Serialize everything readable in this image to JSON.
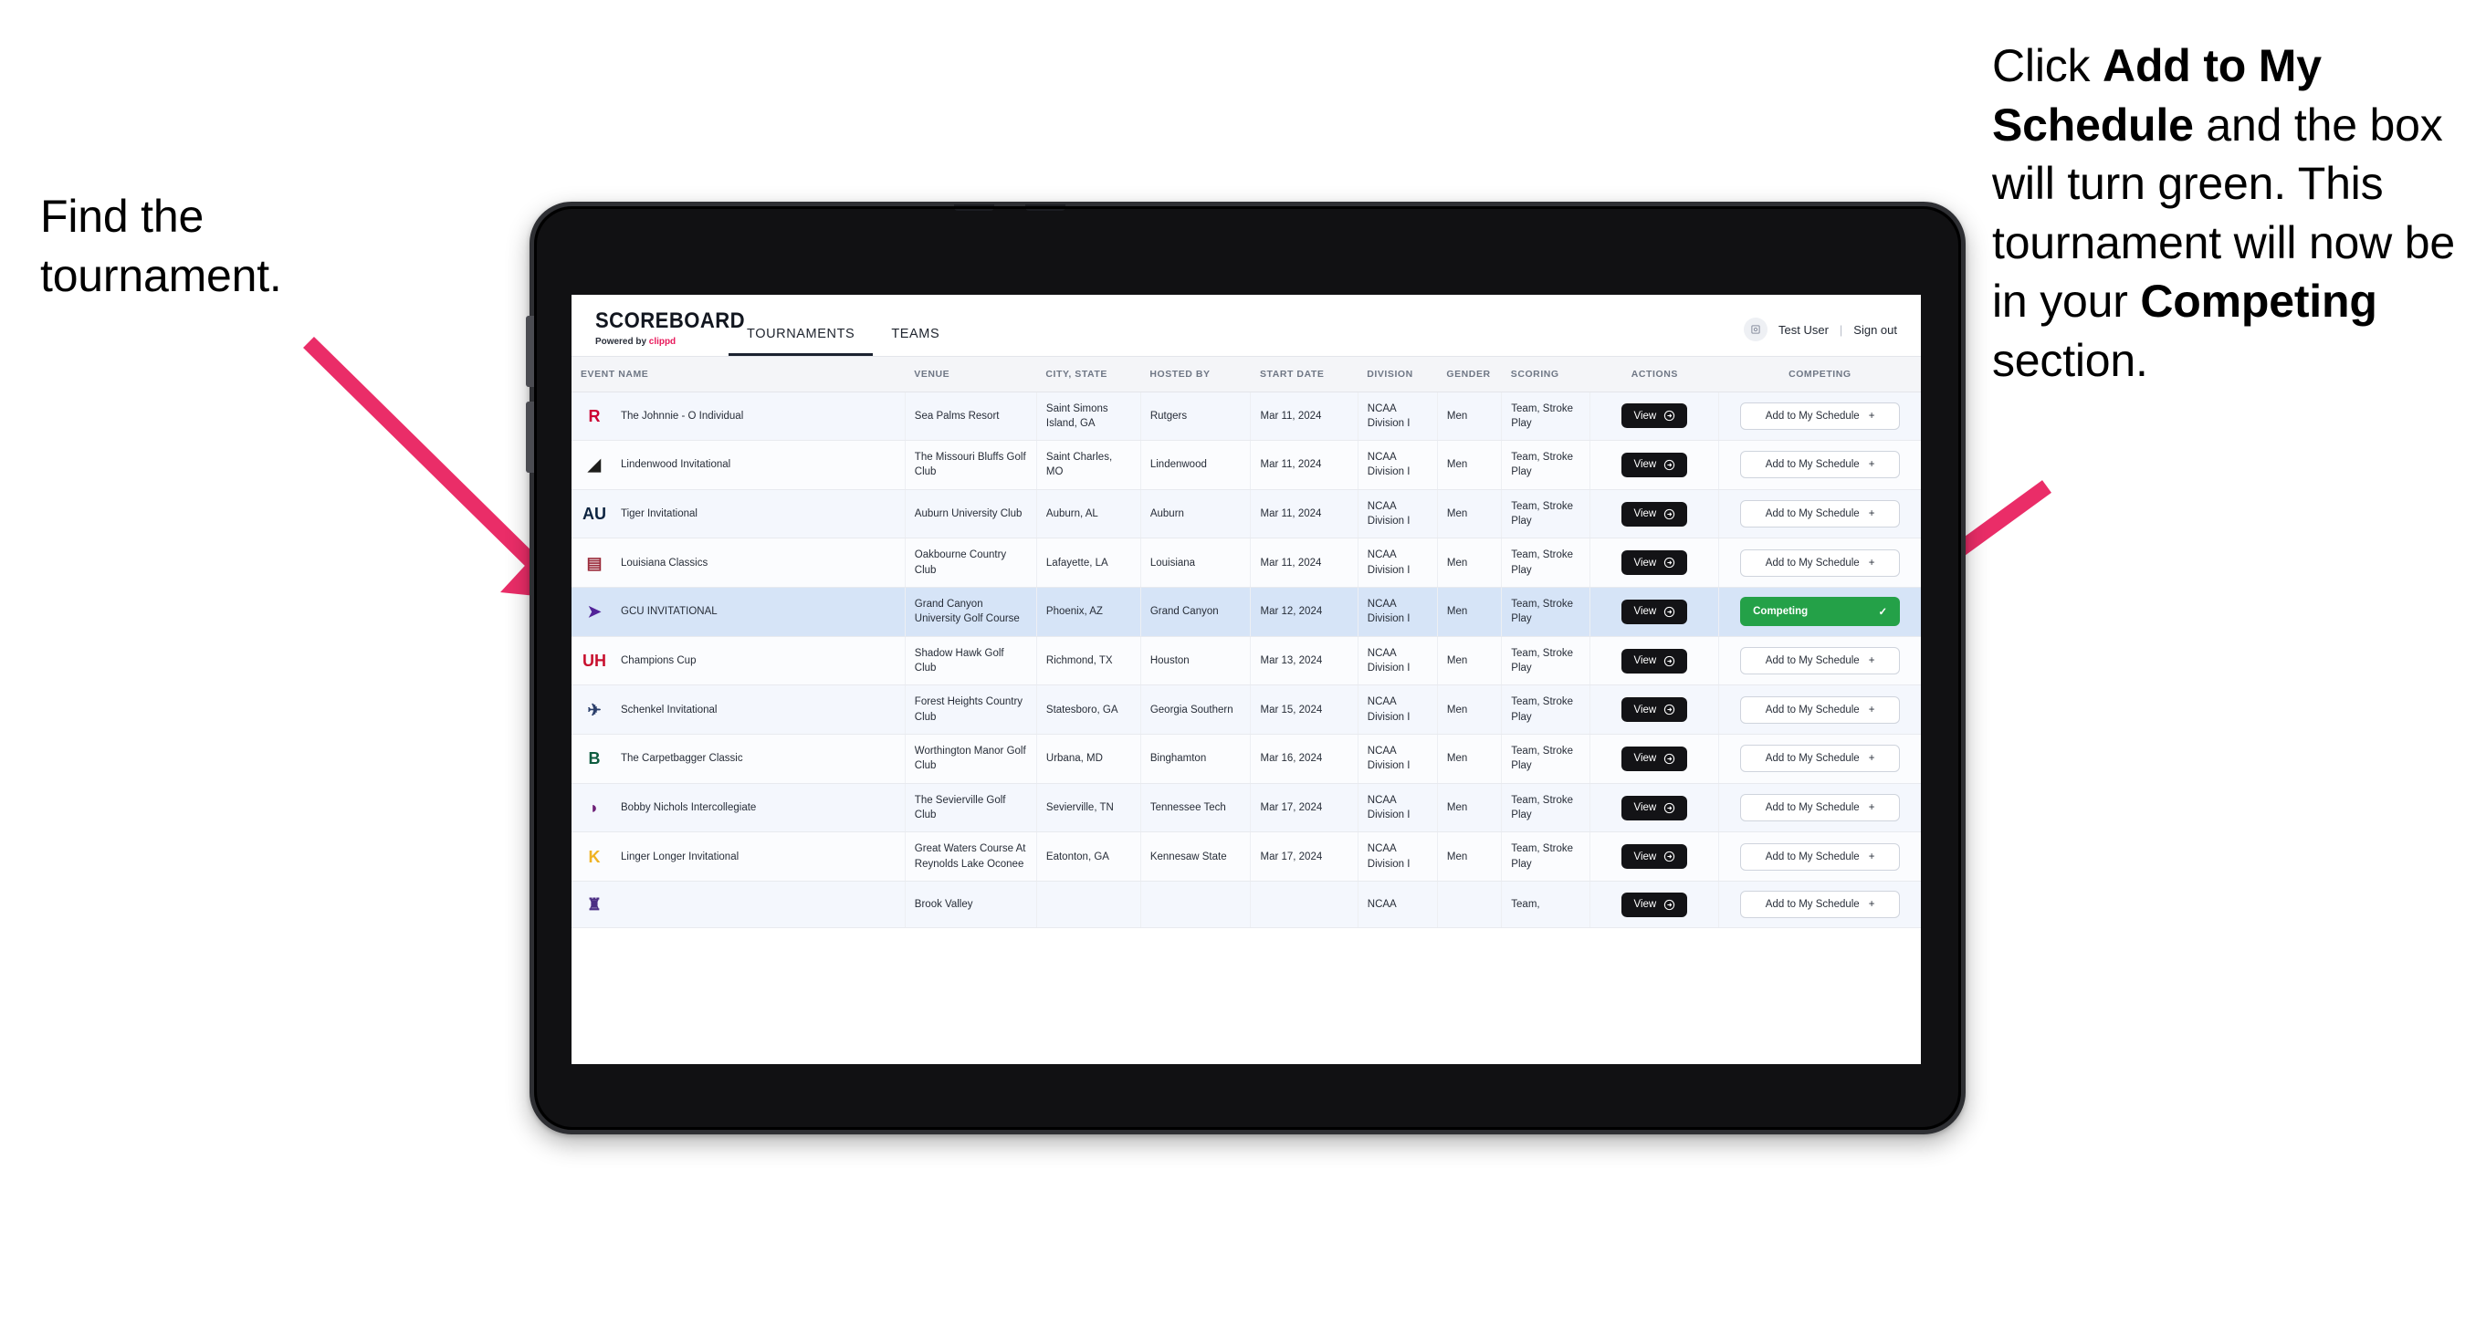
{
  "annotations": {
    "left": {
      "line1": "Find the",
      "line2": "tournament."
    },
    "right": {
      "p1": "Click ",
      "b1": "Add to My Schedule",
      "p2": " and the box will turn green. This tournament will now be in your ",
      "b2": "Competing",
      "p3": " section."
    },
    "arrow_color": "#ea2d68"
  },
  "app": {
    "brand": {
      "name": "SCOREBOARD",
      "powered_prefix": "Powered by ",
      "powered_brand": "clippd"
    },
    "tabs": [
      {
        "label": "TOURNAMENTS",
        "active": true
      },
      {
        "label": "TEAMS",
        "active": false
      }
    ],
    "user": {
      "avatar_icon": "user-avatar-icon",
      "name": "Test User",
      "separator": "|",
      "signout": "Sign out"
    },
    "table": {
      "columns": [
        "EVENT NAME",
        "VENUE",
        "CITY, STATE",
        "HOSTED BY",
        "START DATE",
        "DIVISION",
        "GENDER",
        "SCORING",
        "ACTIONS",
        "COMPETING"
      ],
      "view_label": "View",
      "add_label": "Add to My Schedule",
      "add_plus": "+",
      "competing_label": "Competing",
      "competing_check": "✓",
      "competing_color": "#24a148",
      "rows": [
        {
          "event": "The Johnnie - O Individual",
          "venue": "Sea Palms Resort",
          "city": "Saint Simons Island, GA",
          "hosted_by": "Rutgers",
          "start_date": "Mar 11, 2024",
          "division": "NCAA Division I",
          "gender": "Men",
          "scoring": "Team, Stroke Play",
          "competing": false,
          "logo_glyph": "R",
          "logo_color": "#cc0033"
        },
        {
          "event": "Lindenwood Invitational",
          "venue": "The Missouri Bluffs Golf Club",
          "city": "Saint Charles, MO",
          "hosted_by": "Lindenwood",
          "start_date": "Mar 11, 2024",
          "division": "NCAA Division I",
          "gender": "Men",
          "scoring": "Team, Stroke Play",
          "competing": false,
          "logo_glyph": "◢",
          "logo_color": "#1d1d1b"
        },
        {
          "event": "Tiger Invitational",
          "venue": "Auburn University Club",
          "city": "Auburn, AL",
          "hosted_by": "Auburn",
          "start_date": "Mar 11, 2024",
          "division": "NCAA Division I",
          "gender": "Men",
          "scoring": "Team, Stroke Play",
          "competing": false,
          "logo_glyph": "AU",
          "logo_color": "#0c2340"
        },
        {
          "event": "Louisiana Classics",
          "venue": "Oakbourne Country Club",
          "city": "Lafayette, LA",
          "hosted_by": "Louisiana",
          "start_date": "Mar 11, 2024",
          "division": "NCAA Division I",
          "gender": "Men",
          "scoring": "Team, Stroke Play",
          "competing": false,
          "logo_glyph": "▤",
          "logo_color": "#9a2a3a"
        },
        {
          "event": "GCU INVITATIONAL",
          "venue": "Grand Canyon University Golf Course",
          "city": "Phoenix, AZ",
          "hosted_by": "Grand Canyon",
          "start_date": "Mar 12, 2024",
          "division": "NCAA Division I",
          "gender": "Men",
          "scoring": "Team, Stroke Play",
          "competing": true,
          "logo_glyph": "➤",
          "logo_color": "#522398"
        },
        {
          "event": "Champions Cup",
          "venue": "Shadow Hawk Golf Club",
          "city": "Richmond, TX",
          "hosted_by": "Houston",
          "start_date": "Mar 13, 2024",
          "division": "NCAA Division I",
          "gender": "Men",
          "scoring": "Team, Stroke Play",
          "competing": false,
          "logo_glyph": "UH",
          "logo_color": "#c8102e"
        },
        {
          "event": "Schenkel Invitational",
          "venue": "Forest Heights Country Club",
          "city": "Statesboro, GA",
          "hosted_by": "Georgia Southern",
          "start_date": "Mar 15, 2024",
          "division": "NCAA Division I",
          "gender": "Men",
          "scoring": "Team, Stroke Play",
          "competing": false,
          "logo_glyph": "✈",
          "logo_color": "#2b3f6b"
        },
        {
          "event": "The Carpetbagger Classic",
          "venue": "Worthington Manor Golf Club",
          "city": "Urbana, MD",
          "hosted_by": "Binghamton",
          "start_date": "Mar 16, 2024",
          "division": "NCAA Division I",
          "gender": "Men",
          "scoring": "Team, Stroke Play",
          "competing": false,
          "logo_glyph": "B",
          "logo_color": "#0d5c3f"
        },
        {
          "event": "Bobby Nichols Intercollegiate",
          "venue": "The Sevierville Golf Club",
          "city": "Sevierville, TN",
          "hosted_by": "Tennessee Tech",
          "start_date": "Mar 17, 2024",
          "division": "NCAA Division I",
          "gender": "Men",
          "scoring": "Team, Stroke Play",
          "competing": false,
          "logo_glyph": "◗",
          "logo_color": "#6d2077"
        },
        {
          "event": "Linger Longer Invitational",
          "venue": "Great Waters Course At Reynolds Lake Oconee",
          "city": "Eatonton, GA",
          "hosted_by": "Kennesaw State",
          "start_date": "Mar 17, 2024",
          "division": "NCAA Division I",
          "gender": "Men",
          "scoring": "Team, Stroke Play",
          "competing": false,
          "logo_glyph": "K",
          "logo_color": "#f0b323"
        },
        {
          "event": "",
          "venue": "Brook Valley",
          "city": "",
          "hosted_by": "",
          "start_date": "",
          "division": "NCAA",
          "gender": "",
          "scoring": "Team,",
          "competing": false,
          "logo_glyph": "♜",
          "logo_color": "#4b2e83",
          "partial": true
        }
      ]
    }
  }
}
